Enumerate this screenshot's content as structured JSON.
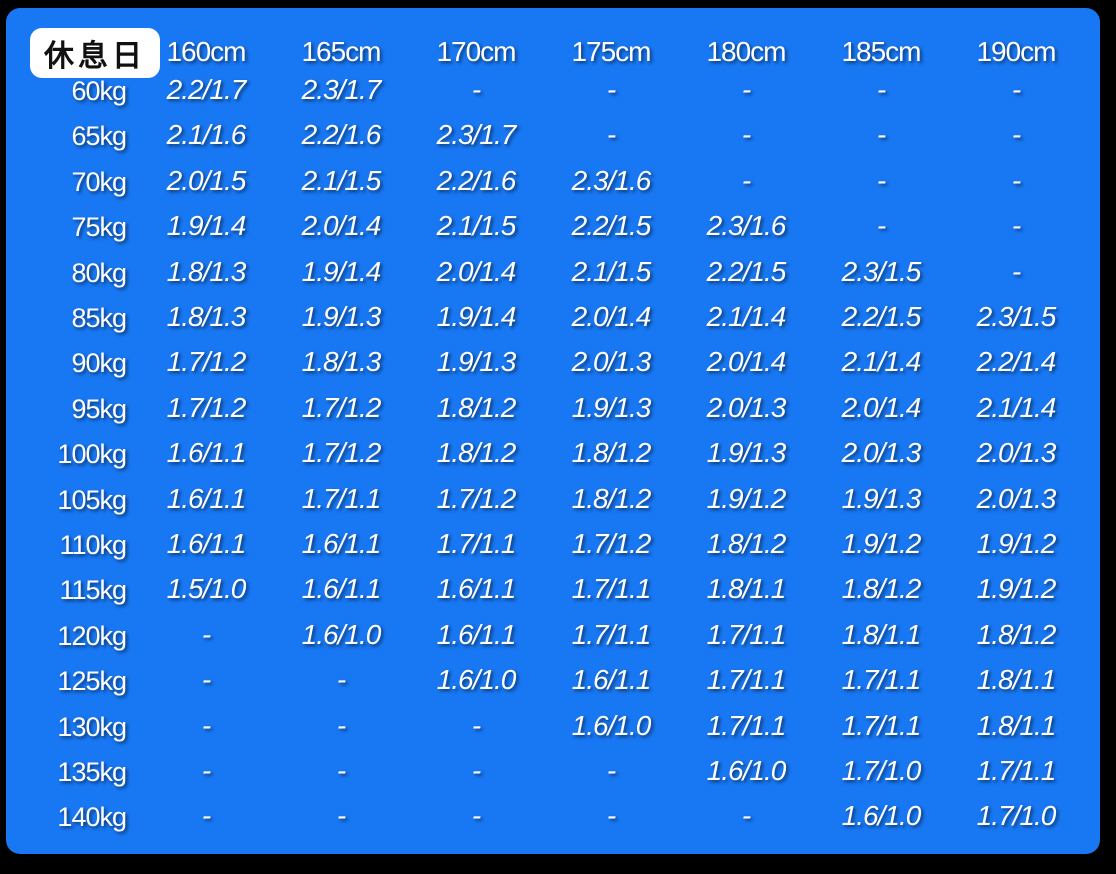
{
  "corner_label": "休息日",
  "columns": [
    "160cm",
    "165cm",
    "170cm",
    "175cm",
    "180cm",
    "185cm",
    "190cm"
  ],
  "rows": [
    {
      "label": "60kg",
      "values": [
        "2.2/1.7",
        "2.3/1.7",
        "-",
        "-",
        "-",
        "-",
        "-"
      ]
    },
    {
      "label": "65kg",
      "values": [
        "2.1/1.6",
        "2.2/1.6",
        "2.3/1.7",
        "-",
        "-",
        "-",
        "-"
      ]
    },
    {
      "label": "70kg",
      "values": [
        "2.0/1.5",
        "2.1/1.5",
        "2.2/1.6",
        "2.3/1.6",
        "-",
        "-",
        "-"
      ]
    },
    {
      "label": "75kg",
      "values": [
        "1.9/1.4",
        "2.0/1.4",
        "2.1/1.5",
        "2.2/1.5",
        "2.3/1.6",
        "-",
        "-"
      ]
    },
    {
      "label": "80kg",
      "values": [
        "1.8/1.3",
        "1.9/1.4",
        "2.0/1.4",
        "2.1/1.5",
        "2.2/1.5",
        "2.3/1.5",
        "-"
      ]
    },
    {
      "label": "85kg",
      "values": [
        "1.8/1.3",
        "1.9/1.3",
        "1.9/1.4",
        "2.0/1.4",
        "2.1/1.4",
        "2.2/1.5",
        "2.3/1.5"
      ]
    },
    {
      "label": "90kg",
      "values": [
        "1.7/1.2",
        "1.8/1.3",
        "1.9/1.3",
        "2.0/1.3",
        "2.0/1.4",
        "2.1/1.4",
        "2.2/1.4"
      ]
    },
    {
      "label": "95kg",
      "values": [
        "1.7/1.2",
        "1.7/1.2",
        "1.8/1.2",
        "1.9/1.3",
        "2.0/1.3",
        "2.0/1.4",
        "2.1/1.4"
      ]
    },
    {
      "label": "100kg",
      "values": [
        "1.6/1.1",
        "1.7/1.2",
        "1.8/1.2",
        "1.8/1.2",
        "1.9/1.3",
        "2.0/1.3",
        "2.0/1.3"
      ]
    },
    {
      "label": "105kg",
      "values": [
        "1.6/1.1",
        "1.7/1.1",
        "1.7/1.2",
        "1.8/1.2",
        "1.9/1.2",
        "1.9/1.3",
        "2.0/1.3"
      ]
    },
    {
      "label": "110kg",
      "values": [
        "1.6/1.1",
        "1.6/1.1",
        "1.7/1.1",
        "1.7/1.2",
        "1.8/1.2",
        "1.9/1.2",
        "1.9/1.2"
      ]
    },
    {
      "label": "115kg",
      "values": [
        "1.5/1.0",
        "1.6/1.1",
        "1.6/1.1",
        "1.7/1.1",
        "1.8/1.1",
        "1.8/1.2",
        "1.9/1.2"
      ]
    },
    {
      "label": "120kg",
      "values": [
        "-",
        "1.6/1.0",
        "1.6/1.1",
        "1.7/1.1",
        "1.7/1.1",
        "1.8/1.1",
        "1.8/1.2"
      ]
    },
    {
      "label": "125kg",
      "values": [
        "-",
        "-",
        "1.6/1.0",
        "1.6/1.1",
        "1.7/1.1",
        "1.7/1.1",
        "1.8/1.1"
      ]
    },
    {
      "label": "130kg",
      "values": [
        "-",
        "-",
        "-",
        "1.6/1.0",
        "1.7/1.1",
        "1.7/1.1",
        "1.8/1.1"
      ]
    },
    {
      "label": "135kg",
      "values": [
        "-",
        "-",
        "-",
        "-",
        "1.6/1.0",
        "1.7/1.0",
        "1.7/1.1"
      ]
    },
    {
      "label": "140kg",
      "values": [
        "-",
        "-",
        "-",
        "-",
        "-",
        "1.6/1.0",
        "1.7/1.0"
      ]
    }
  ],
  "colors": {
    "background": "#000000",
    "panel": "#1877f2",
    "text": "#ffffff",
    "badge": "#ffffff"
  }
}
